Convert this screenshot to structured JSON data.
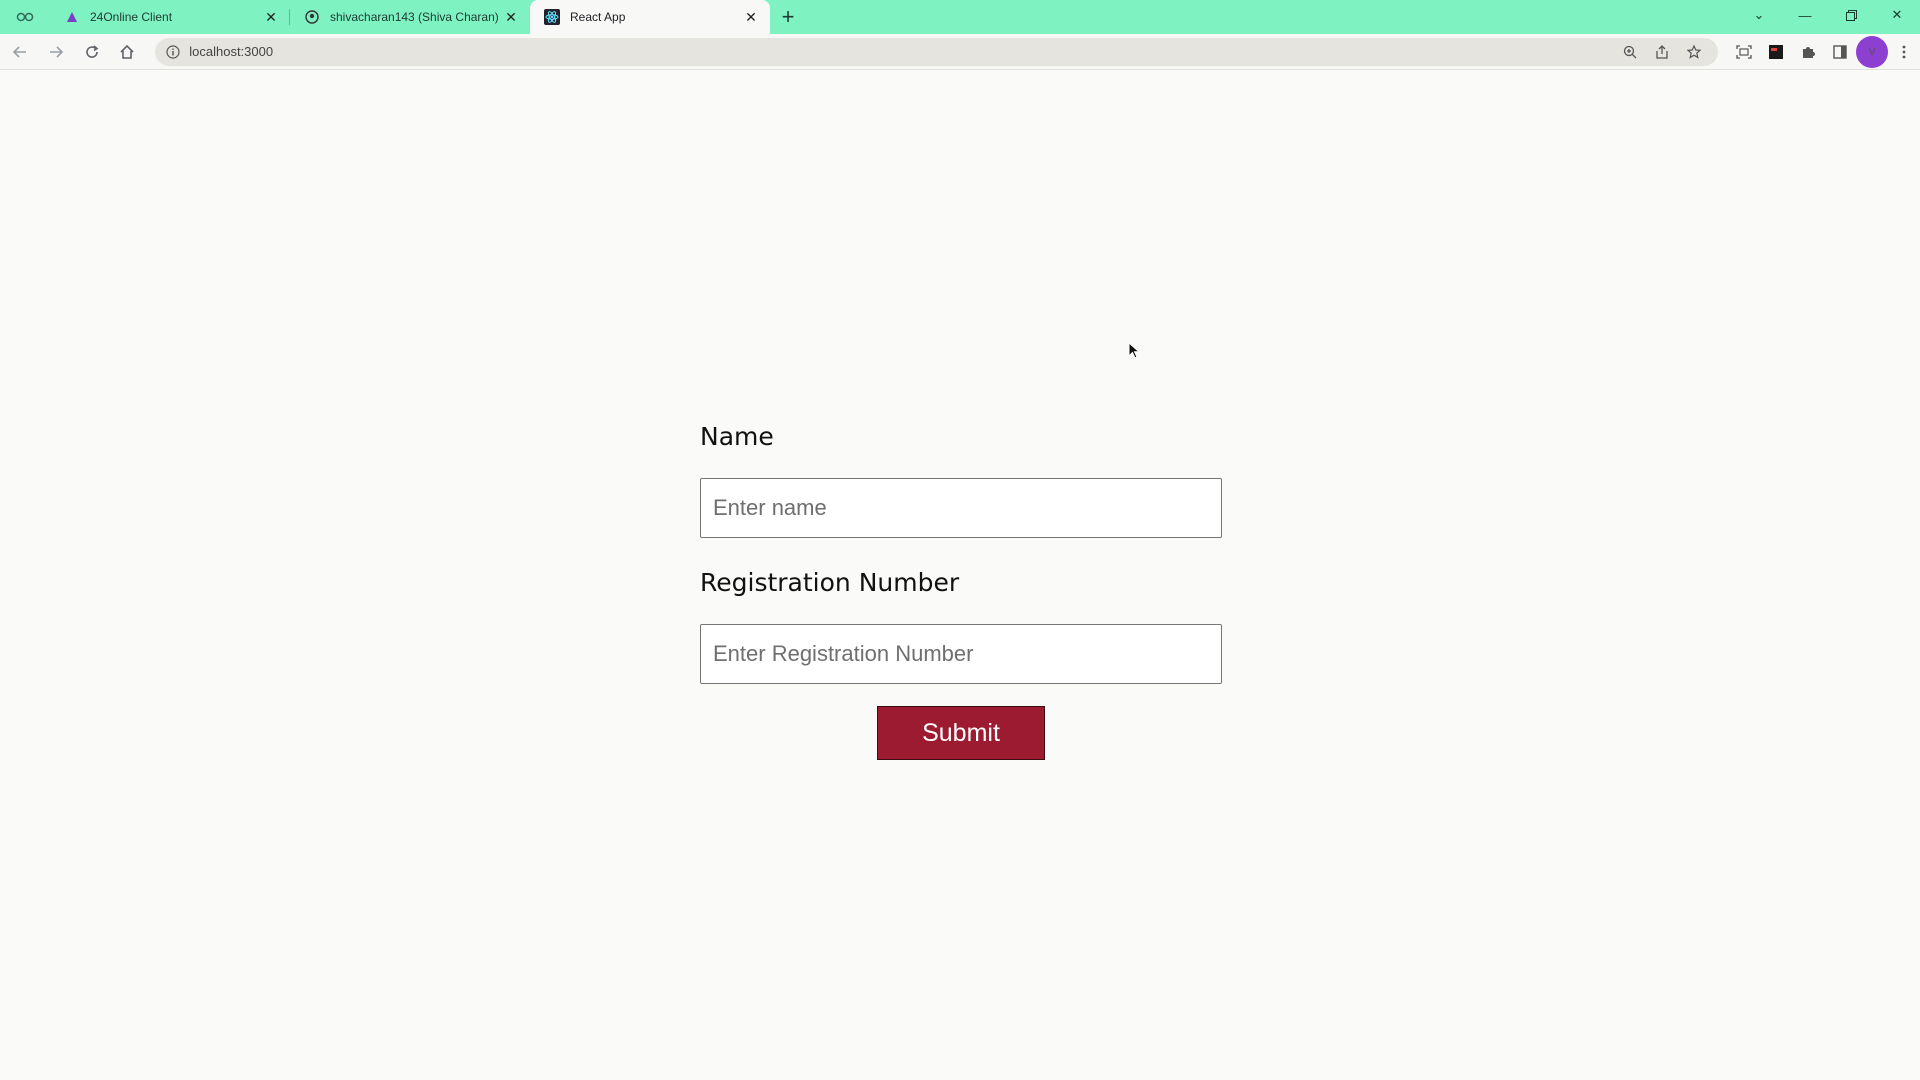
{
  "browser": {
    "tabs": [
      {
        "title": "24Online Client",
        "favicon": "triangle-icon",
        "active": false
      },
      {
        "title": "shivacharan143 (Shiva Charan)",
        "favicon": "github-icon",
        "active": false
      },
      {
        "title": "React App",
        "favicon": "react-icon",
        "active": true
      }
    ],
    "url": "localhost:3000",
    "profile_initial": "V",
    "accent_color": "#7ff2c2"
  },
  "form": {
    "name_label": "Name",
    "name_placeholder": "Enter name",
    "reg_label": "Registration Number",
    "reg_placeholder": "Enter Registration Number",
    "submit_label": "Submit",
    "submit_color": "#9c1b30"
  }
}
